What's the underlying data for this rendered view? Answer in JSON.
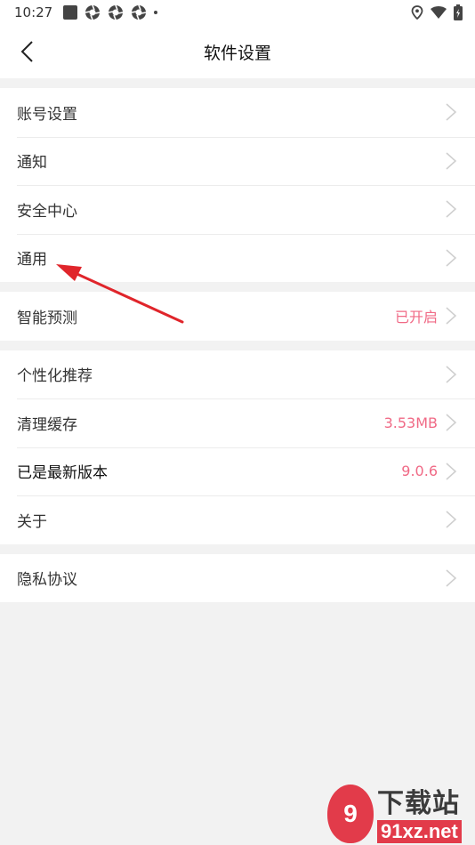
{
  "statusbar": {
    "time": "10:27"
  },
  "header": {
    "title": "软件设置"
  },
  "groups": [
    {
      "items": [
        {
          "label": "账号设置",
          "value": ""
        },
        {
          "label": "通知",
          "value": ""
        },
        {
          "label": "安全中心",
          "value": ""
        },
        {
          "label": "通用",
          "value": ""
        }
      ]
    },
    {
      "items": [
        {
          "label": "智能预测",
          "value": "已开启"
        }
      ]
    },
    {
      "items": [
        {
          "label": "个性化推荐",
          "value": ""
        },
        {
          "label": "清理缓存",
          "value": "3.53MB"
        },
        {
          "label": "已是最新版本",
          "value": "9.0.6"
        },
        {
          "label": "关于",
          "value": ""
        }
      ]
    },
    {
      "items": [
        {
          "label": "隐私协议",
          "value": ""
        }
      ]
    }
  ],
  "watermark": {
    "brand": "下载站",
    "url": "91xz.net",
    "logo_text": "9"
  },
  "colors": {
    "accent": "#f06a86",
    "annotation_arrow": "#e0252b"
  }
}
